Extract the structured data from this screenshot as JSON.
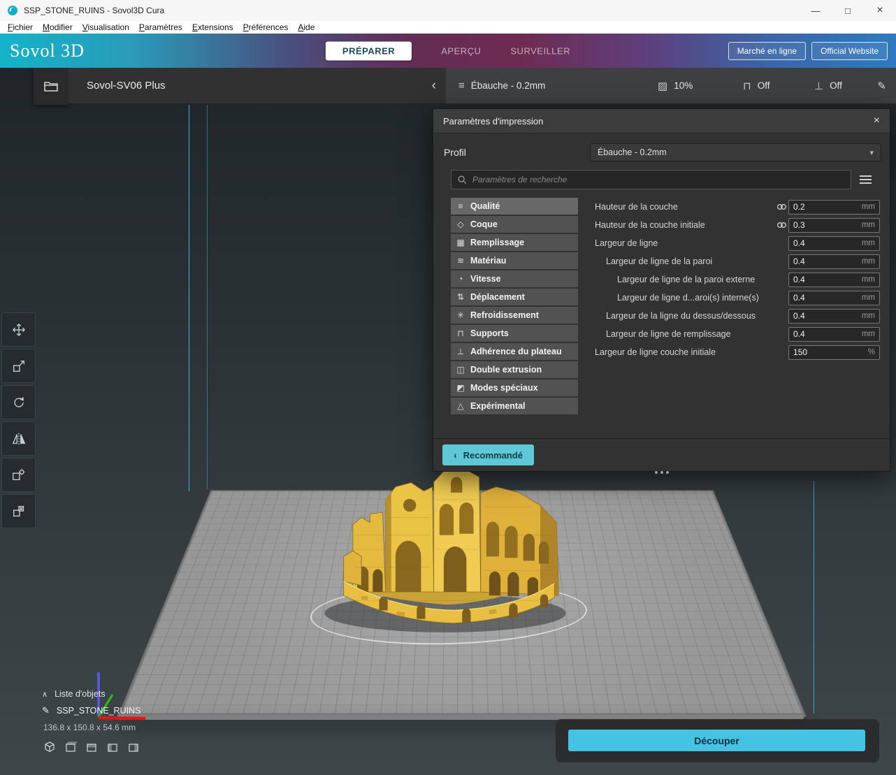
{
  "window": {
    "title": "SSP_STONE_RUINS - Sovol3D Cura",
    "minimize": "—",
    "maximize": "□",
    "close": "×"
  },
  "menubar": {
    "items": [
      "Fichier",
      "Modifier",
      "Visualisation",
      "Paramètres",
      "Extensions",
      "Préférences",
      "Aide"
    ]
  },
  "header": {
    "logo": "Sovol 3D",
    "stages": [
      {
        "label": "PRÉPARER",
        "active": true
      },
      {
        "label": "APERÇU",
        "active": false
      },
      {
        "label": "SURVEILLER",
        "active": false
      }
    ],
    "links": [
      "Marché en ligne",
      "Official Website"
    ]
  },
  "machine": {
    "name": "Sovol-SV06 Plus",
    "collapse_icon": "‹"
  },
  "config_bar": {
    "profile": {
      "icon": "≡",
      "label": "Ébauche - 0.2mm"
    },
    "infill": {
      "icon": "▨",
      "label": "10%"
    },
    "support": {
      "icon": "⊓",
      "label": "Off"
    },
    "adhesion": {
      "icon": "⊥",
      "label": "Off"
    },
    "edit_icon": "✎"
  },
  "print_settings": {
    "title": "Paramètres d'impression",
    "close_icon": "×",
    "profil_label": "Profil",
    "profil_value": "Ébauche - 0.2mm",
    "dropdown_icon": "▾",
    "search_placeholder": "Paramètres de recherche",
    "categories": [
      {
        "label": "Qualité",
        "icon": "≡",
        "active": true
      },
      {
        "label": "Coque",
        "icon": "◇",
        "active": false
      },
      {
        "label": "Remplissage",
        "icon": "▦",
        "active": false
      },
      {
        "label": "Matériau",
        "icon": "≋",
        "active": false
      },
      {
        "label": "Vitesse",
        "icon": "◔",
        "active": false
      },
      {
        "label": "Déplacement",
        "icon": "⇅",
        "active": false
      },
      {
        "label": "Refroidissement",
        "icon": "✳",
        "active": false
      },
      {
        "label": "Supports",
        "icon": "⊓",
        "active": false
      },
      {
        "label": "Adhérence du plateau",
        "icon": "⊥",
        "active": false
      },
      {
        "label": "Double extrusion",
        "icon": "◫",
        "active": false
      },
      {
        "label": "Modes spéciaux",
        "icon": "◩",
        "active": false
      },
      {
        "label": "Expérimental",
        "icon": "△",
        "active": false
      }
    ],
    "settings": [
      {
        "label": "Hauteur de la couche",
        "value": "0.2",
        "unit": "mm",
        "linked": true,
        "indent": 0
      },
      {
        "label": "Hauteur de la couche initiale",
        "value": "0.3",
        "unit": "mm",
        "linked": true,
        "indent": 0
      },
      {
        "label": "Largeur de ligne",
        "value": "0.4",
        "unit": "mm",
        "linked": false,
        "indent": 0
      },
      {
        "label": "Largeur de ligne de la paroi",
        "value": "0.4",
        "unit": "mm",
        "linked": false,
        "indent": 1
      },
      {
        "label": "Largeur de ligne de la paroi externe",
        "value": "0.4",
        "unit": "mm",
        "linked": false,
        "indent": 2
      },
      {
        "label": "Largeur de ligne d...aroi(s) interne(s)",
        "value": "0.4",
        "unit": "mm",
        "linked": false,
        "indent": 2
      },
      {
        "label": "Largeur de la ligne du dessus/dessous",
        "value": "0.4",
        "unit": "mm",
        "linked": false,
        "indent": 1
      },
      {
        "label": "Largeur de ligne de remplissage",
        "value": "0.4",
        "unit": "mm",
        "linked": false,
        "indent": 1
      },
      {
        "label": "Largeur de ligne couche initiale",
        "value": "150",
        "unit": "%",
        "linked": false,
        "indent": 0
      }
    ],
    "recommended_label": "Recommandé",
    "recommended_icon": "‹"
  },
  "tools": [
    {
      "name": "move-tool"
    },
    {
      "name": "scale-tool"
    },
    {
      "name": "rotate-tool"
    },
    {
      "name": "mirror-tool"
    },
    {
      "name": "per-model-settings-tool"
    },
    {
      "name": "support-blocker-tool"
    }
  ],
  "view_icons": [
    "view-3d",
    "view-front",
    "view-top",
    "view-left",
    "view-right"
  ],
  "object_panel": {
    "toggle_icon": "∧",
    "list_label": "Liste d'objets",
    "edit_icon": "✎",
    "object_name": "SSP_STONE_RUINS",
    "dimensions": "136.8 x 150.8 x 54.6 mm"
  },
  "slice": {
    "label": "Découper"
  },
  "colors": {
    "accent": "#5FC8D7",
    "slice_button": "#45C3E5",
    "model": "#E8BF42",
    "header_teal": "#16B4C8",
    "header_magenta": "#6D2B50",
    "header_blue": "#2F7AC0",
    "build_plate": "#9E9E9E",
    "line_blue": "#35B5E5"
  }
}
